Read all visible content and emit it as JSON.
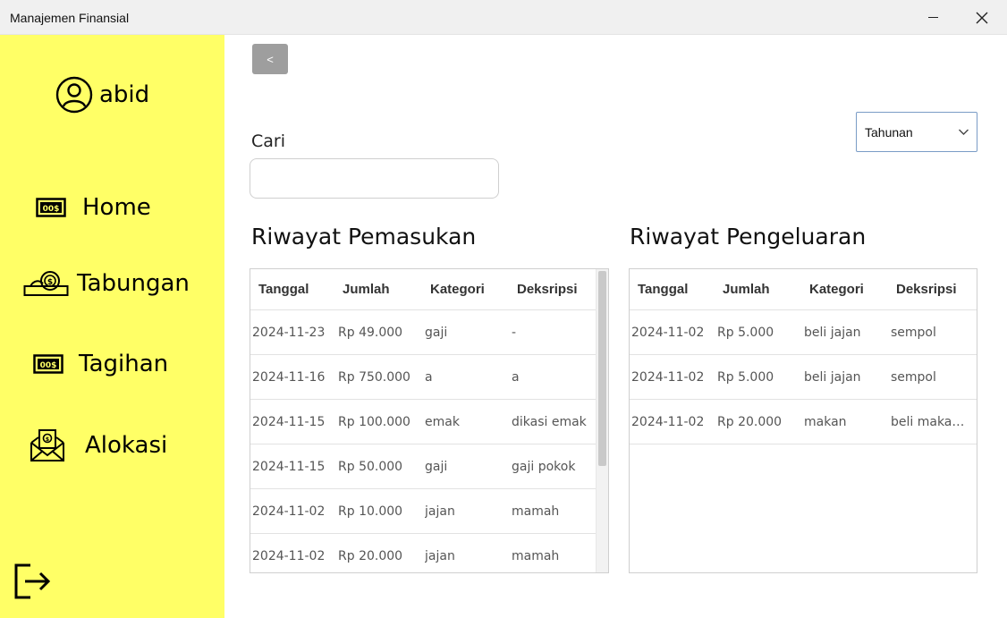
{
  "window": {
    "title": "Manajemen Finansial"
  },
  "sidebar": {
    "user_name": "abid",
    "items": [
      {
        "label": "Home",
        "icon": "money-bill-icon"
      },
      {
        "label": "Tabungan",
        "icon": "coin-hand-icon"
      },
      {
        "label": "Tagihan",
        "icon": "money-bill-icon"
      },
      {
        "label": "Alokasi",
        "icon": "envelope-money-icon"
      }
    ]
  },
  "main": {
    "back_label": "<",
    "search": {
      "label": "Cari",
      "value": "",
      "placeholder": ""
    },
    "period_select": {
      "value": "Tahunan"
    },
    "income": {
      "title": "Riwayat Pemasukan",
      "columns": [
        "Tanggal",
        "Jumlah",
        "Kategori",
        "Deksripsi"
      ],
      "rows": [
        [
          "2024-11-23",
          "Rp 49.000",
          "gaji",
          "-"
        ],
        [
          "2024-11-16",
          "Rp 750.000",
          "a",
          "a"
        ],
        [
          "2024-11-15",
          "Rp 100.000",
          "emak",
          "dikasi emak"
        ],
        [
          "2024-11-15",
          "Rp 50.000",
          "gaji",
          "gaji pokok"
        ],
        [
          "2024-11-02",
          "Rp 10.000",
          "jajan",
          "mamah"
        ],
        [
          "2024-11-02",
          "Rp 20.000",
          "jajan",
          "mamah"
        ]
      ]
    },
    "expense": {
      "title": "Riwayat Pengeluaran",
      "columns": [
        "Tanggal",
        "Jumlah",
        "Kategori",
        "Deksripsi"
      ],
      "rows": [
        [
          "2024-11-02",
          "Rp 5.000",
          "beli jajan",
          "sempol"
        ],
        [
          "2024-11-02",
          "Rp 5.000",
          "beli jajan",
          "sempol"
        ],
        [
          "2024-11-02",
          "Rp 20.000",
          "makan",
          "beli makan ..."
        ]
      ]
    }
  },
  "colors": {
    "sidebar": "#ffff66",
    "back_button": "#9e9e9e",
    "select_border": "#7a9cc6"
  }
}
